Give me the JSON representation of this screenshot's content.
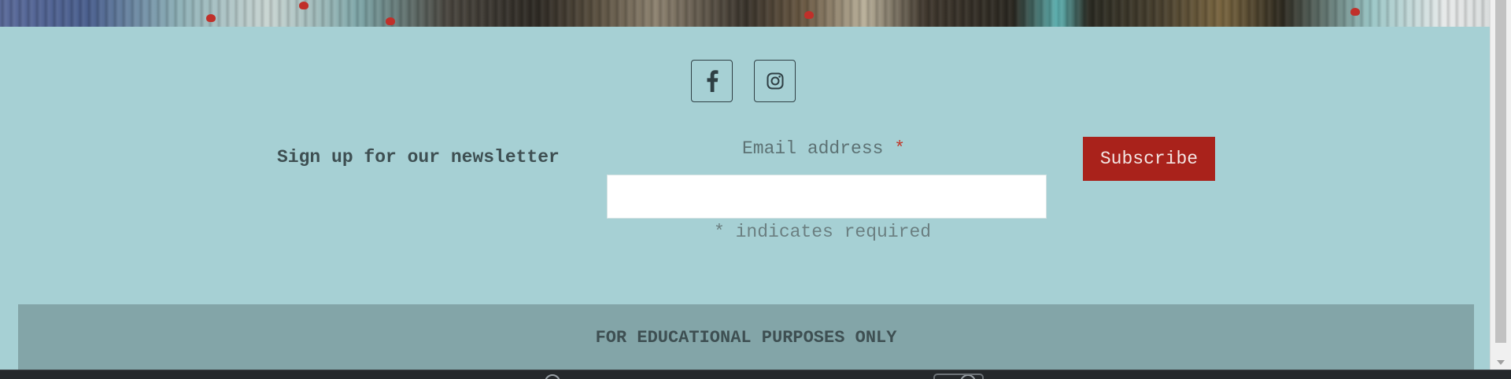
{
  "social": {
    "facebook_icon": "facebook-f",
    "instagram_icon": "instagram"
  },
  "newsletter": {
    "label": "Sign up for our newsletter",
    "email_label": "Email address",
    "required_marker": "*",
    "email_value": "",
    "required_note": "* indicates required",
    "subscribe_label": "Subscribe"
  },
  "footer": {
    "disclaimer": "FOR EDUCATIONAL PURPOSES ONLY"
  },
  "colors": {
    "background": "#a6d0d4",
    "footer_band": "#83a5a8",
    "subscribe_button": "#a9221b",
    "required_star": "#c0392b"
  }
}
